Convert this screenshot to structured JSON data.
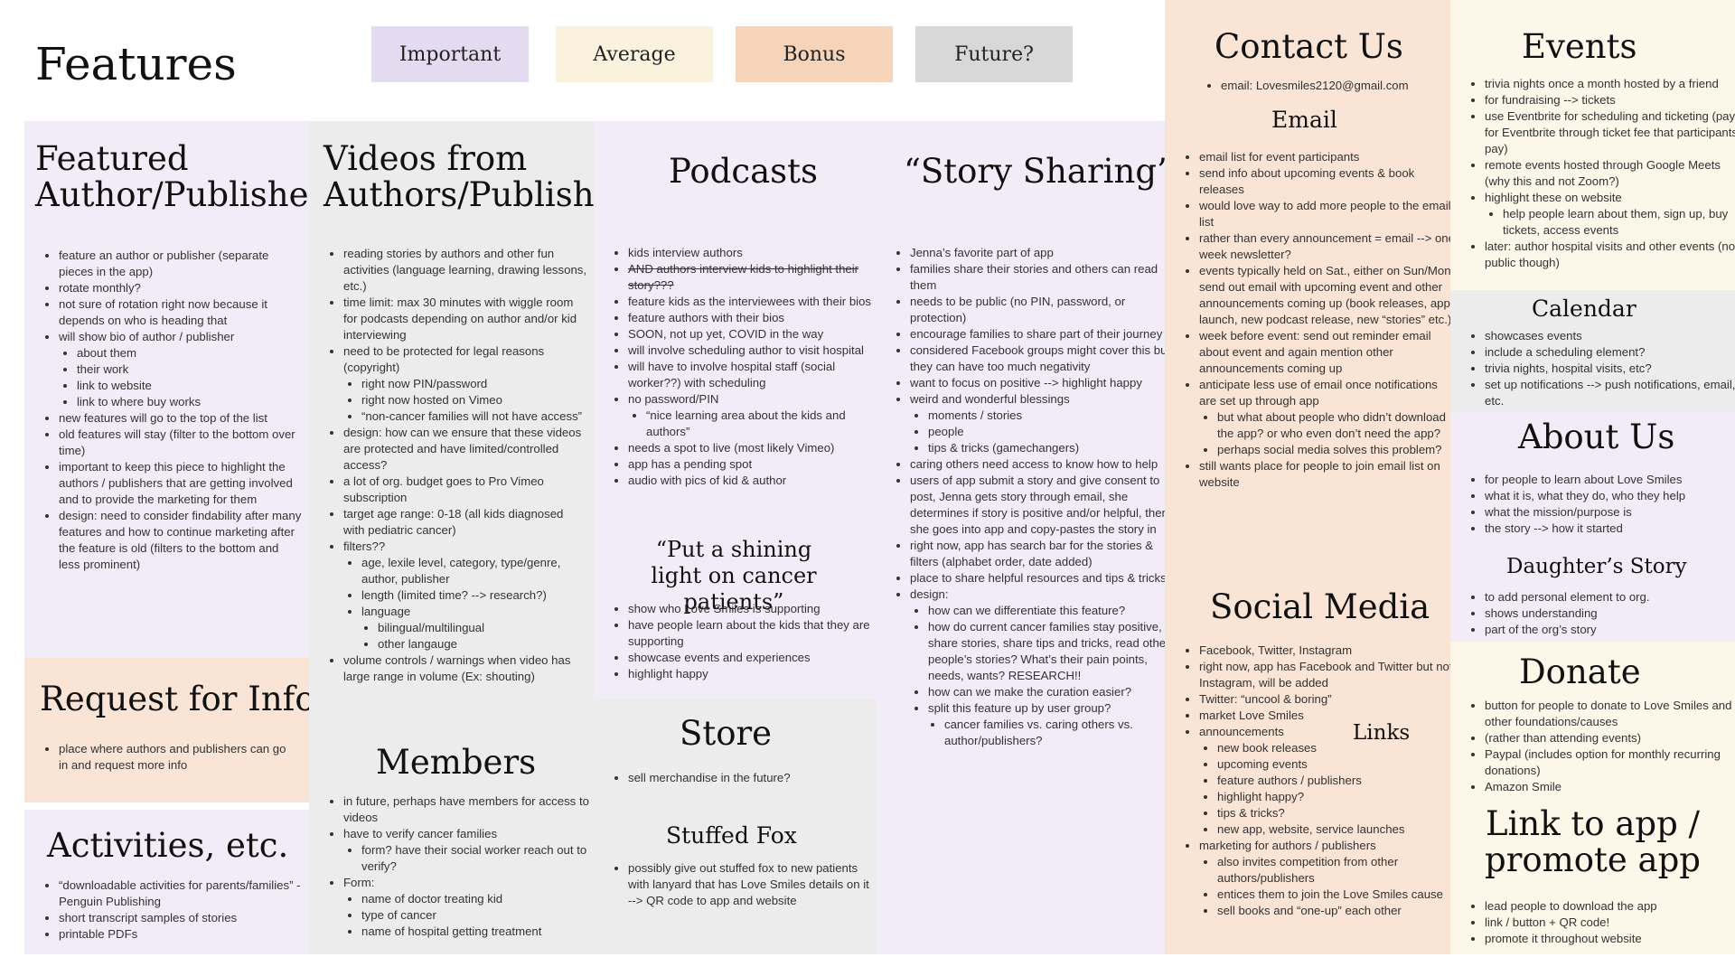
{
  "page_title": "Features",
  "legend": {
    "important": "Important",
    "average": "Average",
    "bonus": "Bonus",
    "future": "Future?"
  },
  "colors": {
    "important": "#e4dbf1",
    "average": "#faf2dc",
    "bonus": "#f5d4b9",
    "future": "#d8d8d8",
    "panel_purple": "#f1ecf7",
    "panel_gray": "#ececec",
    "panel_peach": "#f9e4d6",
    "panel_cream": "#fcf7e8"
  },
  "featured": {
    "title": "Featured Author/Publisher",
    "items": [
      "feature an author or publisher (separate pieces in the app)",
      "rotate monthly?",
      "not sure of rotation right now because it depends on who is heading that",
      "will show bio of author / publisher",
      "about them",
      "their work",
      "link to website",
      "link to where buy works",
      "new features will go to the top of the list",
      "old features will stay (filter to the bottom over time)",
      "important to keep this piece to highlight the authors / publishers that are getting involved and to provide the marketing for them",
      "design: need to consider findability after many features and how to continue marketing after the feature is old (filters to the bottom and less prominent)"
    ]
  },
  "request_info": {
    "title": "Request for Info",
    "items": [
      "place where authors and publishers can go in and request more info"
    ]
  },
  "activities": {
    "title": "Activities, etc.",
    "items": [
      "“downloadable activities for parents/families” -Penguin Publishing",
      "short transcript samples of stories",
      "printable PDFs"
    ]
  },
  "videos": {
    "title": "Videos from Authors/Publishers",
    "items": [
      "reading stories by authors and other fun activities (language learning, drawing lessons, etc.)",
      "time limit: max 30 minutes with wiggle room for podcasts depending on author and/or kid interviewing",
      "need to be protected for legal reasons (copyright)",
      "right now PIN/password",
      "right now hosted on Vimeo",
      "“non-cancer families will not have access”",
      "design: how can we ensure that these videos are protected and have limited/controlled access?",
      "a lot of org. budget goes to Pro Vimeo subscription",
      "target age range: 0-18 (all kids diagnosed with pediatric cancer)",
      "filters??",
      "age, lexile level, category, type/genre, author, publisher",
      "length (limited time? --> research?)",
      "language",
      "bilingual/multilingual",
      "other langauge",
      "volume controls / warnings when video has large range in volume (Ex: shouting)"
    ]
  },
  "members": {
    "title": "Members",
    "items": [
      "in future, perhaps have members for access to videos",
      "have to verify cancer families",
      "form? have their social worker reach out to verify?",
      "Form:",
      "name of doctor treating kid",
      "type of cancer",
      "name of hospital getting treatment"
    ]
  },
  "podcasts": {
    "title": "Podcasts",
    "items": [
      "kids interview authors",
      "AND authors interview kids to highlight their story???",
      "feature kids as the interviewees with their bios",
      "feature authors with their bios",
      "SOON, not up yet, COVID in the way",
      "will involve scheduling author to visit hospital",
      "will have to involve hospital staff (social worker??) with scheduling",
      "no password/PIN",
      "“nice learning area about the kids and authors”",
      "needs a spot to live (most likely Vimeo)",
      "app has a pending spot",
      "audio with pics of kid & author"
    ]
  },
  "shining": {
    "title": "“Put a shining light on cancer patients”",
    "items": [
      "show who Love Smiles is supporting",
      "have people learn about the kids that they are supporting",
      "showcase events and experiences",
      "highlight happy"
    ]
  },
  "store": {
    "title": "Store",
    "items": [
      "sell merchandise in the future?"
    ]
  },
  "stuffed_fox": {
    "title": "Stuffed Fox",
    "items": [
      "possibly give out stuffed fox to new patients with lanyard that has Love Smiles details on it --> QR code to app and website"
    ]
  },
  "story": {
    "title": "“Story Sharing”",
    "items": [
      "Jenna’s favorite part of app",
      "families share their stories and others can read them",
      "needs to be public (no PIN, password, or protection)",
      "encourage families to share part of their journey",
      "considered Facebook groups might cover this but they can have too much negativity",
      "want to focus on positive --> highlight happy",
      "weird and wonderful blessings",
      "moments / stories",
      "people",
      "tips & tricks (gamechangers)",
      "caring others need access to know how to help",
      "users of app submit a story and give consent to post, Jenna gets story through email, she determines if story is positive and/or helpful, then she goes into app and copy-pastes the story in",
      "right now, app has search bar for the stories & filters (alphabet order, date added)",
      "place to share helpful resources and tips & tricks",
      "design:",
      "how can we differentiate this feature?",
      "how do current cancer families stay positive, share stories, share tips and tricks, read other people’s stories? What’s their pain points, needs, wants? RESEARCH!!",
      "how can we make the curation easier?",
      "split this feature up by user group?",
      "cancer families vs. caring others vs. author/publishers?"
    ]
  },
  "contact": {
    "title": "Contact Us",
    "items": [
      "email: Lovesmiles2120@gmail.com"
    ]
  },
  "email": {
    "title": "Email",
    "items": [
      "email list for event participants",
      "send info about upcoming events & book releases",
      "would love way to add more people to the email list",
      "rather than every announcement = email --> one week newsletter?",
      "events typically held on Sat., either on Sun/Mon send out email with upcoming event and other announcements coming up (book releases, app launch, new podcast release, new “stories” etc.)",
      "week before event: send out reminder email about event and again mention other announcements coming up",
      "anticipate less use of email once notifications are set up through app",
      "but what about people who didn’t download the app? or who even don’t need the app?",
      "perhaps social media solves this problem?",
      "still wants place for people to join email list on website"
    ]
  },
  "social": {
    "title": "Social Media",
    "links_label": "Links",
    "items": [
      "Facebook, Twitter, Instagram",
      "right now, app has Facebook and Twitter but not Instagram, will be added",
      "Twitter: “uncool & boring”",
      "market Love Smiles",
      "announcements",
      "new book releases",
      "upcoming events",
      "feature authors / publishers",
      "highlight happy?",
      "tips & tricks?",
      "new app, website, service launches",
      "marketing for authors / publishers",
      "also invites competition from other authors/publishers",
      "entices them to join the Love Smiles cause",
      "sell books and “one-up” each other"
    ]
  },
  "events": {
    "title": "Events",
    "items": [
      "trivia nights once a month hosted by a friend",
      "for fundraising --> tickets",
      "use Eventbrite for scheduling and ticketing (pay for Eventbrite through ticket fee that participants pay)",
      "remote events hosted through Google Meets (why this and not Zoom?)",
      "highlight these on website",
      "help people learn about them, sign up, buy tickets, access events",
      "later: author hospital visits and other events (not public though)"
    ]
  },
  "calendar": {
    "title": "Calendar",
    "items": [
      "showcases events",
      "include a scheduling element?",
      "trivia nights, hospital visits, etc?",
      "set up notifications --> push notifications, email, etc."
    ]
  },
  "about": {
    "title": "About Us",
    "items": [
      "for people to learn about Love Smiles",
      "what it is, what they do, who they help",
      "what the mission/purpose is",
      "the story --> how it started"
    ]
  },
  "daughter": {
    "title": "Daughter’s Story",
    "items": [
      "to add personal element to org.",
      "shows understanding",
      "part of the org’s story"
    ]
  },
  "donate": {
    "title": "Donate",
    "items": [
      "button for people to donate to Love Smiles and other foundations/causes",
      "(rather than attending events)",
      "Paypal (includes option for monthly recurring donations)",
      "Amazon Smile"
    ]
  },
  "link_app": {
    "title": "Link to app / promote app",
    "items": [
      "lead people to download the app",
      "link / button + QR code!",
      "promote it throughout website"
    ]
  }
}
